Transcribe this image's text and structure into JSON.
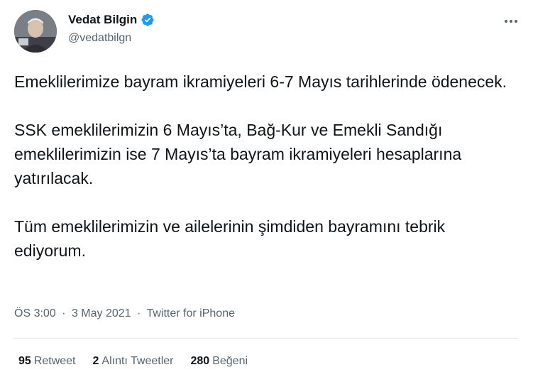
{
  "author": {
    "display_name": "Vedat Bilgin",
    "handle": "@vedatbilgn",
    "verified_icon": "verified-badge-icon",
    "avatar_icon": "avatar"
  },
  "more_icon": "more-horizontal-icon",
  "tweet": {
    "paragraphs": [
      "Emeklilerimize bayram ikramiyeleri 6-7 Mayıs tarihlerinde ödenecek.",
      "SSK emeklilerimizin 6 Mayıs’ta, Bağ-Kur ve Emekli Sandığı emeklilerimizin ise 7 Mayıs’ta bayram ikramiyeleri hesaplarına yatırılacak.",
      "Tüm emeklilerimizin ve ailelerinin şimdiden bayramını tebrik ediyorum."
    ],
    "time": "ÖS 3:00",
    "separator": "·",
    "date": "3 May 2021",
    "source": "Twitter for iPhone"
  },
  "stats": {
    "retweets": {
      "count": "95",
      "label": "Retweet"
    },
    "quotes": {
      "count": "2",
      "label": "Alıntı Tweetler"
    },
    "likes": {
      "count": "280",
      "label": "Beğeni"
    }
  },
  "colors": {
    "primary_text": "#0f1419",
    "secondary_text": "#536471",
    "verified_blue": "#1d9bf0",
    "divider": "#e1e8ed"
  }
}
